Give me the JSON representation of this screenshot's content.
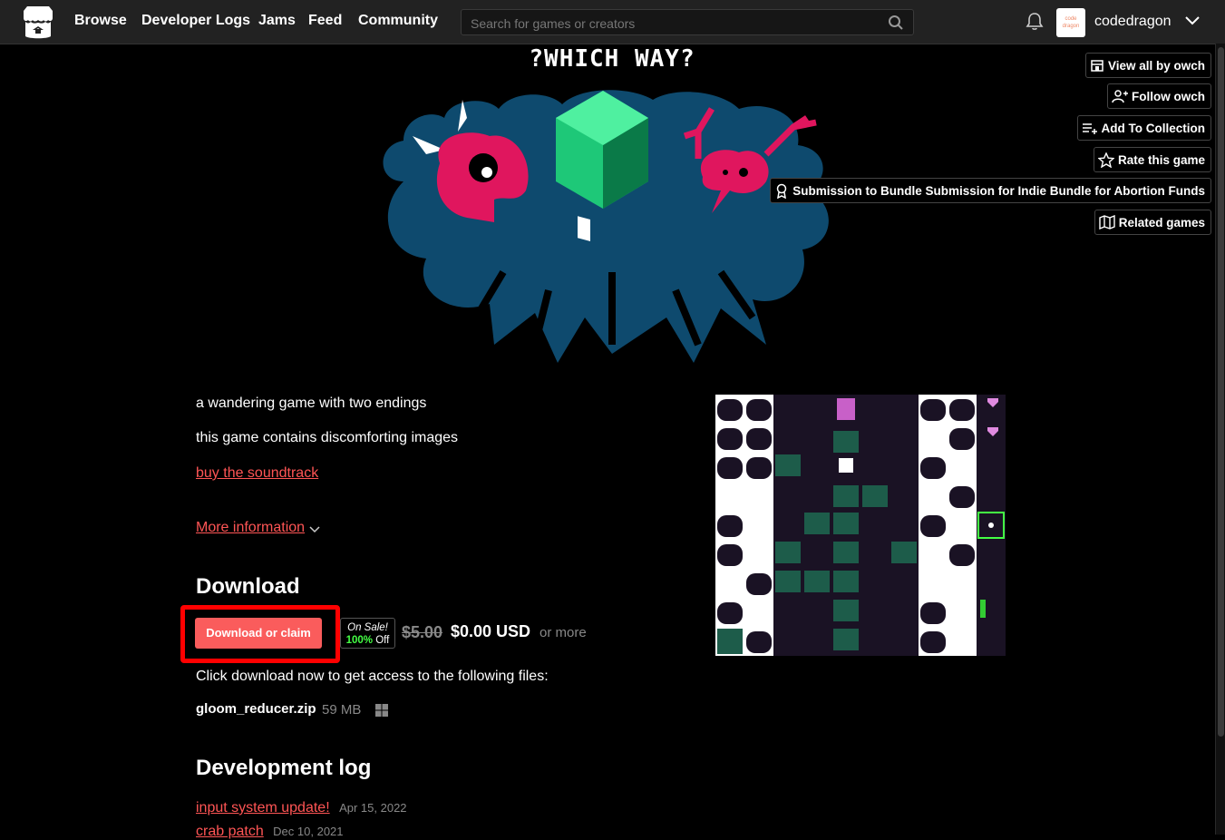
{
  "nav": {
    "links": [
      "Browse",
      "Developer Logs",
      "Jams",
      "Feed",
      "Community"
    ],
    "search_placeholder": "Search for games or creators",
    "username": "codedragon",
    "avatar_text": "code dragon"
  },
  "sidebar_actions": {
    "view_all": "View all by owch",
    "follow": "Follow owch",
    "add_collection": "Add To Collection",
    "rate": "Rate this game",
    "submission": "Submission to Bundle Submission for Indie Bundle for Abortion Funds",
    "related": "Related games"
  },
  "game": {
    "title_art": "?WHICH WAY?",
    "description_1": "a wandering game with two endings",
    "description_2": "this game contains discomforting images",
    "soundtrack_link": "buy the soundtrack",
    "more_info": "More information"
  },
  "download": {
    "heading": "Download",
    "button": "Download or claim",
    "sale_line1": "On Sale!",
    "sale_pct": "100%",
    "sale_off": "Off",
    "old_price": "$5.00",
    "new_price": "$0.00 USD",
    "or_more": "or more",
    "instructions": "Click download now to get access to the following files:",
    "file_name": "gloom_reducer.zip",
    "file_size": "59 MB"
  },
  "devlog": {
    "heading": "Development log",
    "entries": [
      {
        "title": "input system update!",
        "date": "Apr 15, 2022"
      },
      {
        "title": "crab patch",
        "date": "Dec 10, 2021"
      }
    ]
  },
  "colors": {
    "topbar": "#222222",
    "accent": "#fa5c5c",
    "link": "#ff5555",
    "art_blue": "#0e4a6e",
    "art_pink": "#e0165e",
    "art_green": "#1ec878"
  }
}
